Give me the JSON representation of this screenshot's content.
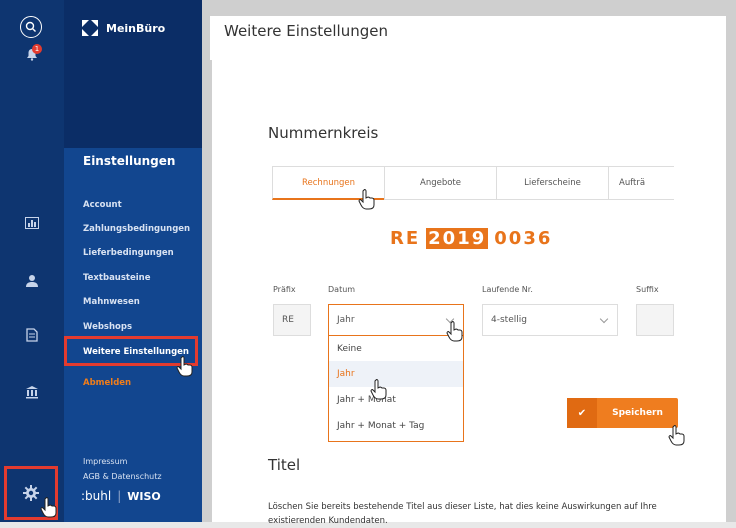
{
  "brand": {
    "name": "MeinBüro"
  },
  "rail": {
    "notification_count": "1"
  },
  "menu": {
    "title": "Einstellungen",
    "items": [
      {
        "label": "Account"
      },
      {
        "label": "Zahlungsbedingungen"
      },
      {
        "label": "Lieferbedingungen"
      },
      {
        "label": "Textbausteine"
      },
      {
        "label": "Mahnwesen"
      },
      {
        "label": "Webshops"
      },
      {
        "label": "Weitere Einstellungen"
      },
      {
        "label": "Abmelden"
      }
    ],
    "footer": {
      "impressum": "Impressum",
      "agb": "AGB & Datenschutz"
    },
    "vendor": {
      "buhl": ":buhl",
      "wiso": "WISO"
    }
  },
  "page": {
    "title": "Weitere Einstellungen"
  },
  "nummernkreis": {
    "title": "Nummernkreis",
    "tabs": [
      {
        "label": "Rechnungen",
        "active": true
      },
      {
        "label": "Angebote"
      },
      {
        "label": "Lieferscheine"
      },
      {
        "label": "Aufträ"
      }
    ],
    "preview": {
      "prefix": "RE",
      "year": "2019",
      "number": "0036"
    },
    "fields": {
      "praefix": {
        "label": "Präfix",
        "value": "RE"
      },
      "datum": {
        "label": "Datum",
        "value": "Jahr"
      },
      "laufende": {
        "label": "Laufende Nr.",
        "value": "4-stellig"
      },
      "suffix": {
        "label": "Suffix",
        "value": ""
      }
    },
    "datum_options": [
      {
        "label": "Keine"
      },
      {
        "label": "Jahr",
        "selected": true
      },
      {
        "label": "Jahr + Monat"
      },
      {
        "label": "Jahr + Monat + Tag"
      }
    ],
    "save_label": "Speichern"
  },
  "titel": {
    "title": "Titel",
    "text": "Löschen Sie bereits bestehende Titel aus dieser Liste, hat dies keine Auswirkungen auf Ihre existierenden Kundendaten."
  },
  "colors": {
    "accent": "#e8741b",
    "nav_dark": "#0e3570",
    "highlight": "#e33b2f"
  }
}
